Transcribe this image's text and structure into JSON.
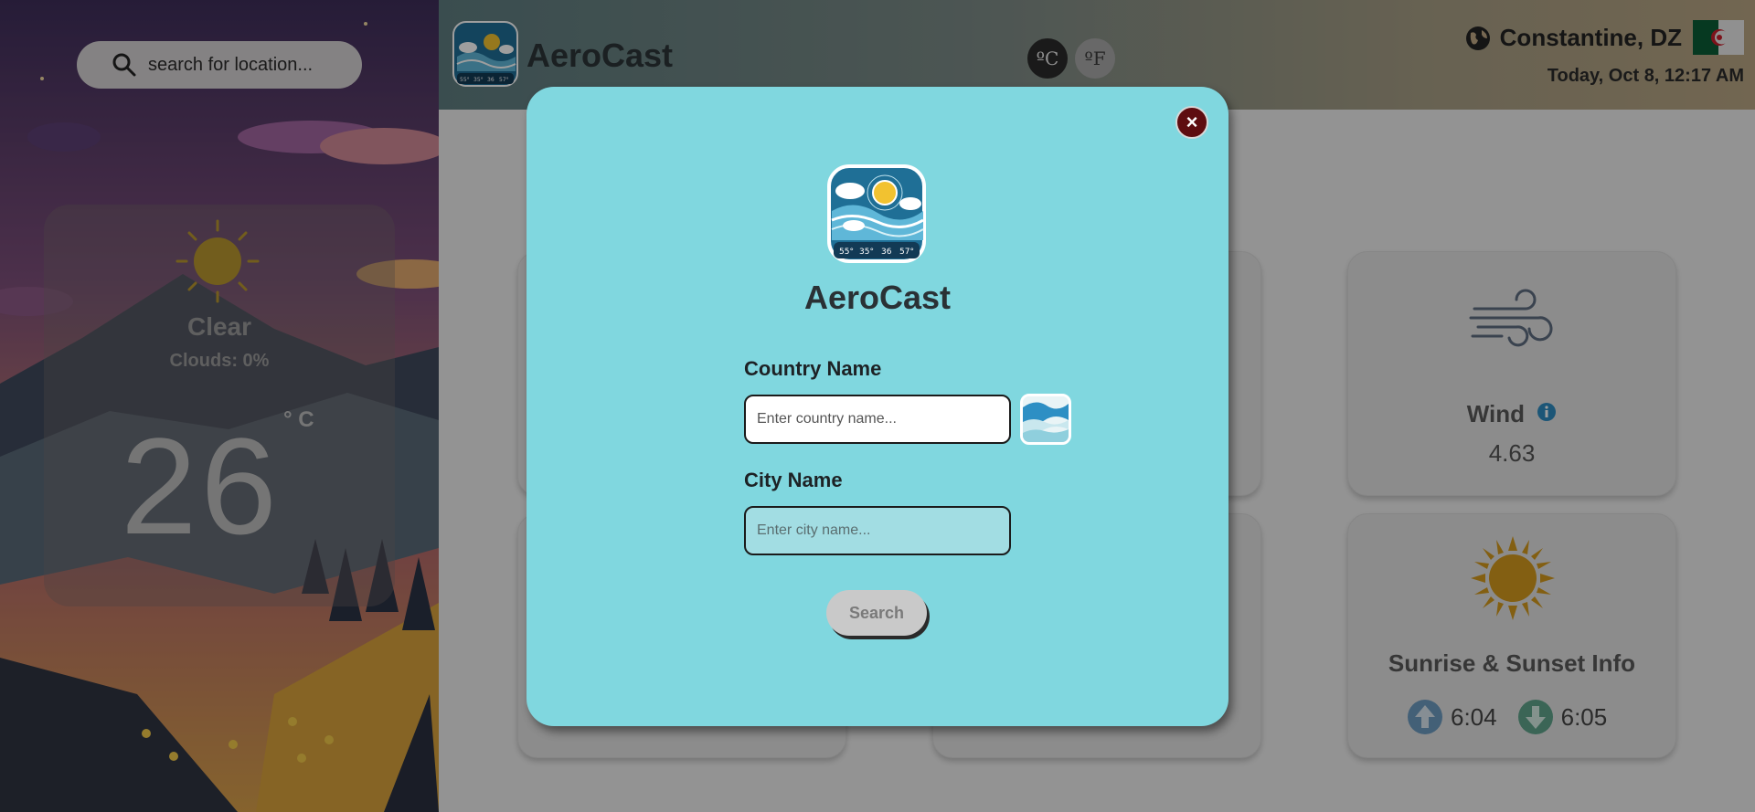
{
  "sidebar": {
    "search_placeholder": "search for location...",
    "condition": "Clear",
    "clouds": "Clouds: 0%",
    "temperature": "26",
    "unit": "° C"
  },
  "header": {
    "app_name": "AeroCast",
    "unit_c": "ºC",
    "unit_f": "ºF",
    "location": "Constantine, DZ",
    "datetime": "Today, Oct 8, 12:17 AM"
  },
  "cards": {
    "wind": {
      "title": "Wind",
      "value": "4.63"
    },
    "sun": {
      "title": "Sunrise & Sunset Info",
      "sunrise": "6:04",
      "sunset": "6:05"
    }
  },
  "modal": {
    "title": "AeroCast",
    "country_label": "Country Name",
    "country_placeholder": "Enter country name...",
    "city_label": "City Name",
    "city_placeholder": "Enter city name...",
    "search_label": "Search",
    "close_label": "×"
  },
  "logo_text": {
    "t1": "55°",
    "t2": "35°",
    "t3": "36",
    "t4": "57°"
  },
  "colors": {
    "modal_bg": "#80d7df",
    "close_bg": "#5e0d10",
    "accent_sun": "#f2c230"
  }
}
